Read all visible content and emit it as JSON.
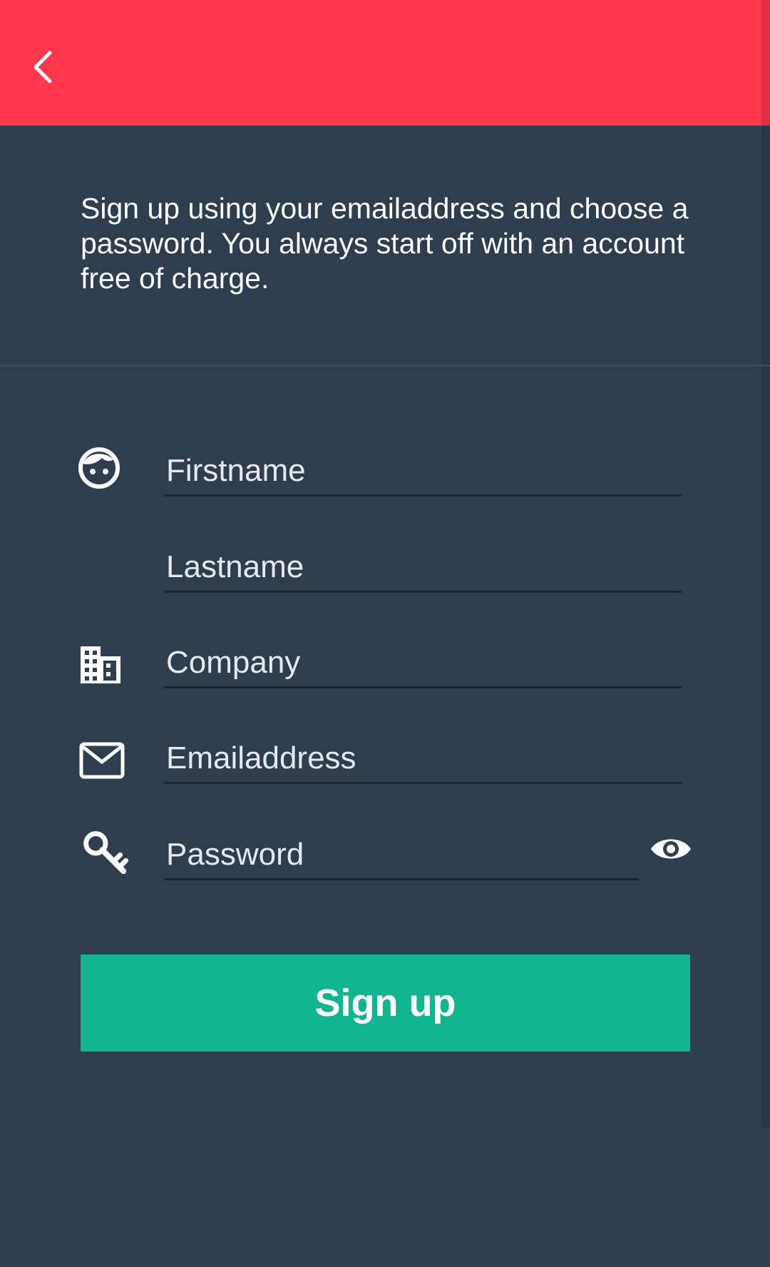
{
  "colors": {
    "app_bar": "#fe374d",
    "background": "#2f3e4f",
    "button": "#11b592",
    "text": "#ffffff"
  },
  "app_bar": {
    "back_icon": "chevron-left-icon"
  },
  "intro": {
    "text": "Sign up using your emailaddress and choose a password. You always start off with an account free of charge."
  },
  "form": {
    "firstname": {
      "placeholder": "Firstname",
      "icon": "face-icon"
    },
    "lastname": {
      "placeholder": "Lastname"
    },
    "company": {
      "placeholder": "Company",
      "icon": "building-icon"
    },
    "email": {
      "placeholder": "Emailaddress",
      "icon": "envelope-icon"
    },
    "password": {
      "placeholder": "Password",
      "icon": "key-icon",
      "toggle_icon": "eye-icon"
    }
  },
  "submit": {
    "label": "Sign up"
  }
}
